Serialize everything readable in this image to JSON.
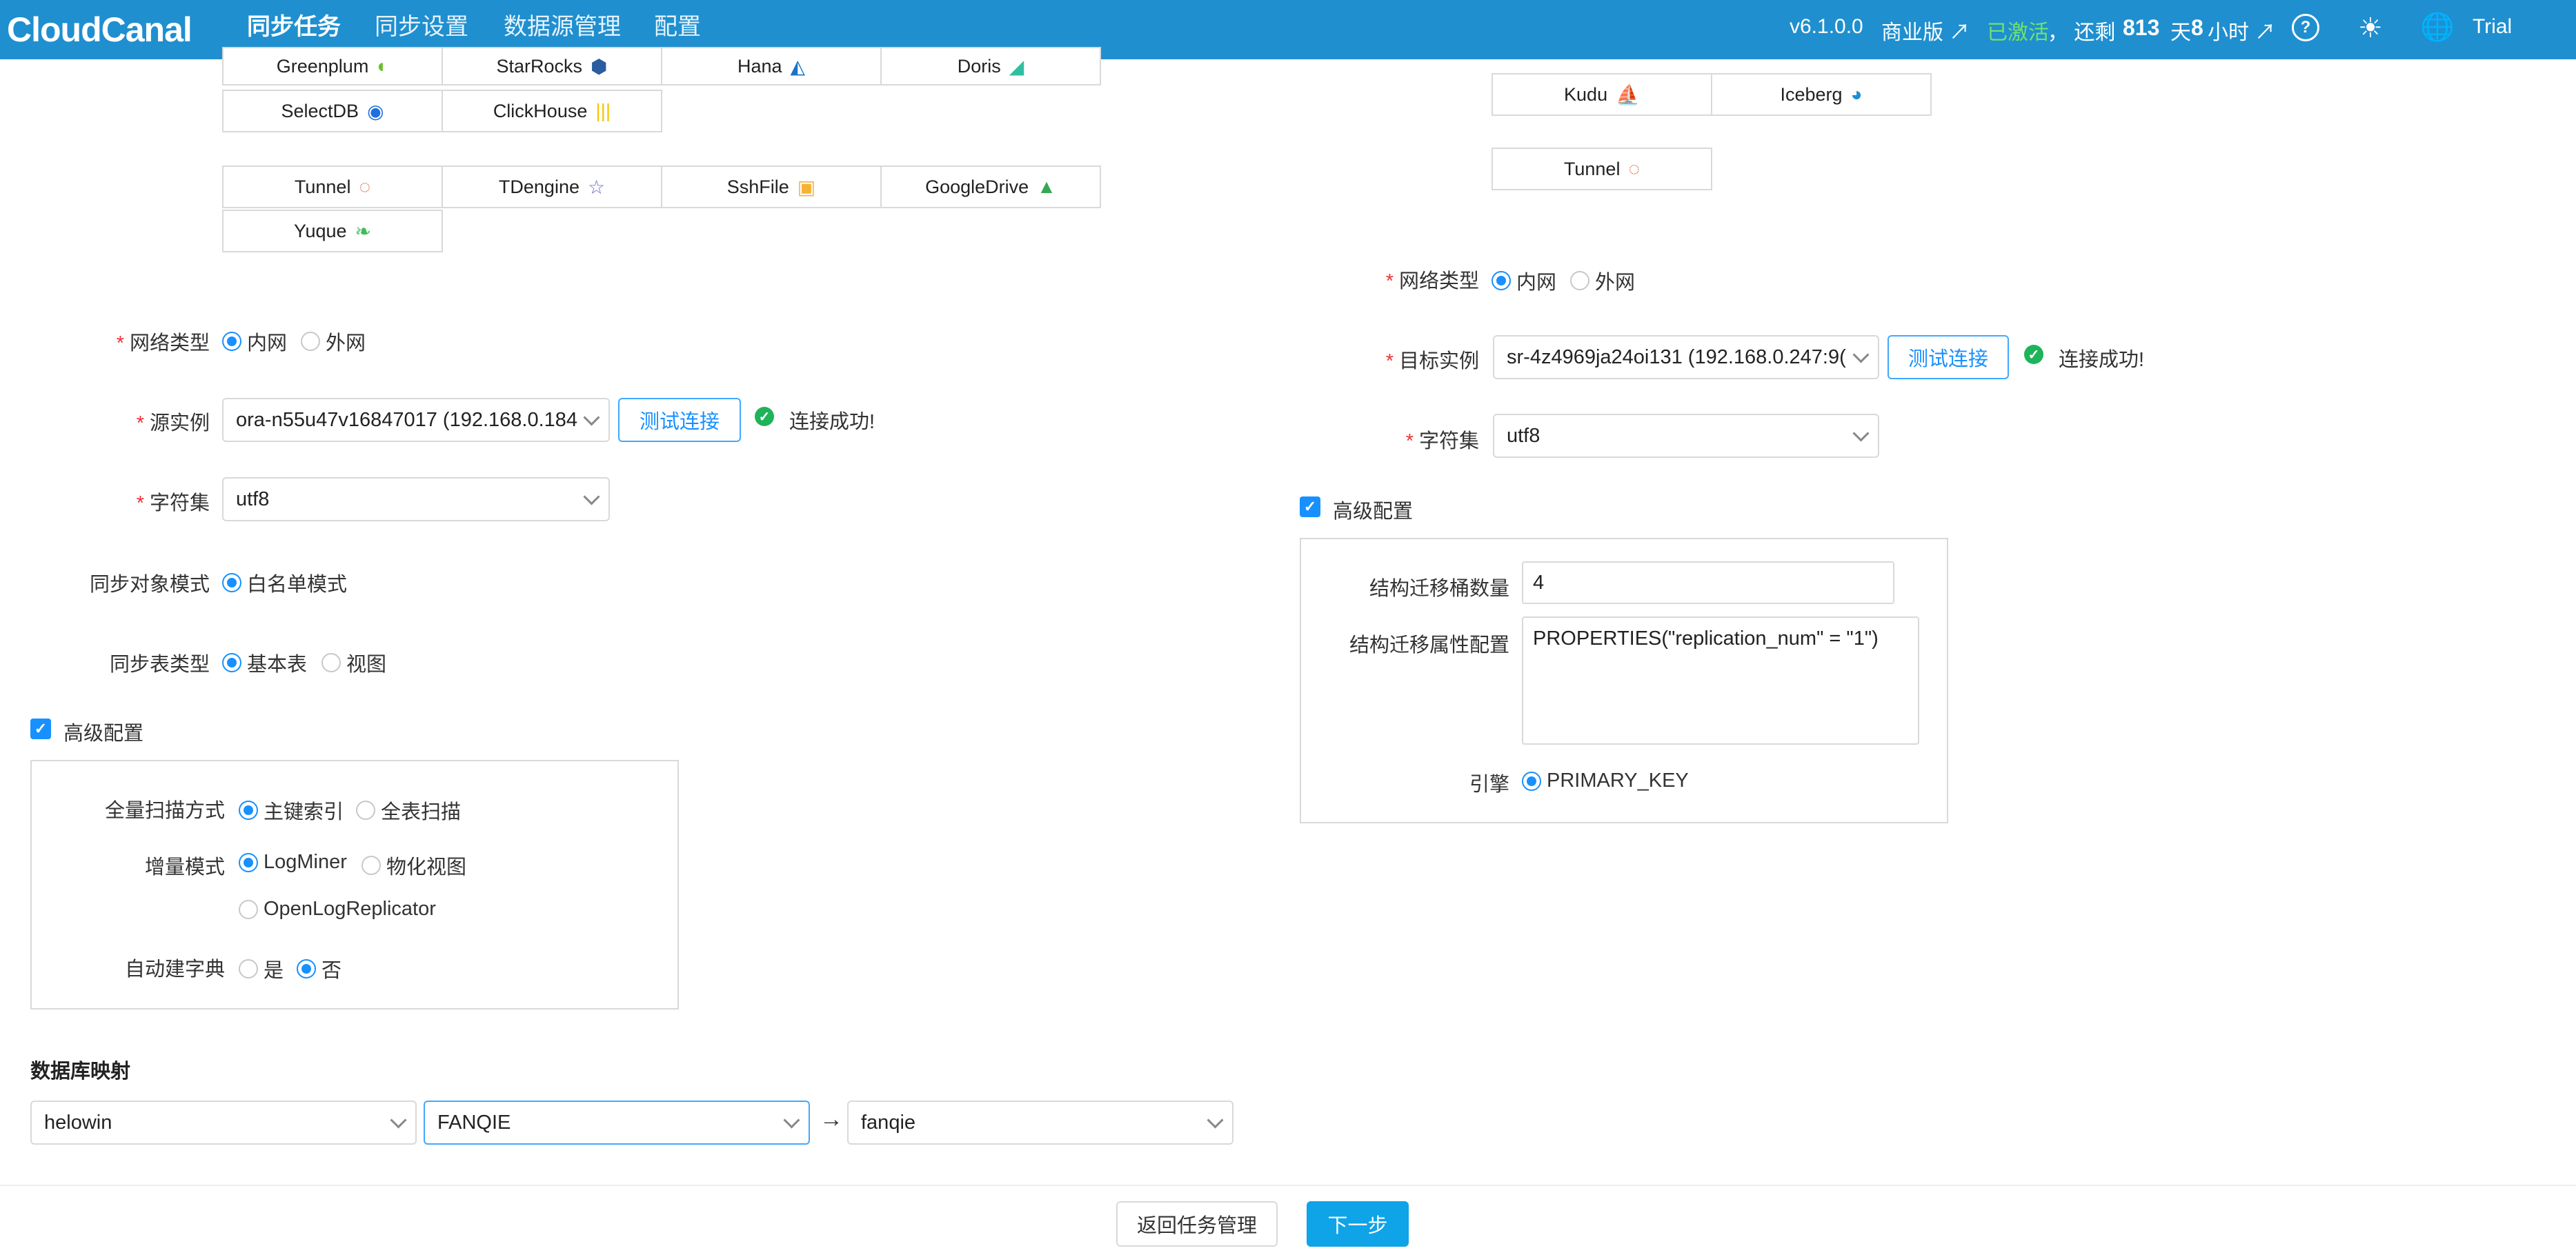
{
  "header": {
    "logo": "CloudCanal",
    "nav": [
      "同步任务",
      "同步设置",
      "数据源管理",
      "配置"
    ],
    "version": "v6.1.0.0",
    "edition": "商业版 ↗",
    "activated": "已激活",
    "remain_prefix": "，  还剩",
    "remain_days": "813",
    "remain_day_unit": "天",
    "remain_hours": "8",
    "remain_hour_unit": "小时 ↗",
    "user": "Trial"
  },
  "source": {
    "db_row1": [
      "Greenplum",
      "StarRocks",
      "Hana",
      "Doris"
    ],
    "db_row2": [
      "SelectDB",
      "ClickHouse"
    ],
    "db_row3": [
      "Tunnel",
      "TDengine",
      "SshFile",
      "GoogleDrive"
    ],
    "db_row4": [
      "Yuque"
    ],
    "network_label": "网络类型",
    "network_opts": [
      "内网",
      "外网"
    ],
    "instance_label": "源实例",
    "instance_value": "ora-n55u47v16847017 (192.168.0.184",
    "test_btn": "测试连接",
    "success": "连接成功!",
    "charset_label": "字符集",
    "charset_value": "utf8",
    "obj_mode_label": "同步对象模式",
    "obj_mode_opt": "白名单模式",
    "table_type_label": "同步表类型",
    "table_type_opts": [
      "基本表",
      "视图"
    ],
    "adv_label": "高级配置",
    "scan_label": "全量扫描方式",
    "scan_opts": [
      "主键索引",
      "全表扫描"
    ],
    "incr_label": "增量模式",
    "incr_opts": [
      "LogMiner",
      "物化视图",
      "OpenLogReplicator"
    ],
    "dict_label": "自动建字典",
    "dict_opts": [
      "是",
      "否"
    ]
  },
  "target": {
    "db_row1": [
      "Kudu",
      "Iceberg"
    ],
    "db_row2": [
      "Tunnel"
    ],
    "network_label": "网络类型",
    "network_opts": [
      "内网",
      "外网"
    ],
    "instance_label": "目标实例",
    "instance_value": "sr-4z4969ja24oi131 (192.168.0.247:9(",
    "test_btn": "测试连接",
    "success": "连接成功!",
    "charset_label": "字符集",
    "charset_value": "utf8",
    "adv_label": "高级配置",
    "bucket_label": "结构迁移桶数量",
    "bucket_value": "4",
    "props_label": "结构迁移属性配置",
    "props_value": "PROPERTIES(\"replication_num\" = \"1\")",
    "engine_label": "引擎",
    "engine_opt": "PRIMARY_KEY"
  },
  "mapping": {
    "title": "数据库映射",
    "src_db": "helowin",
    "src_schema": "FANQIE",
    "dst_db": "fanqie"
  },
  "footer": {
    "back": "返回任务管理",
    "next": "下一步"
  }
}
